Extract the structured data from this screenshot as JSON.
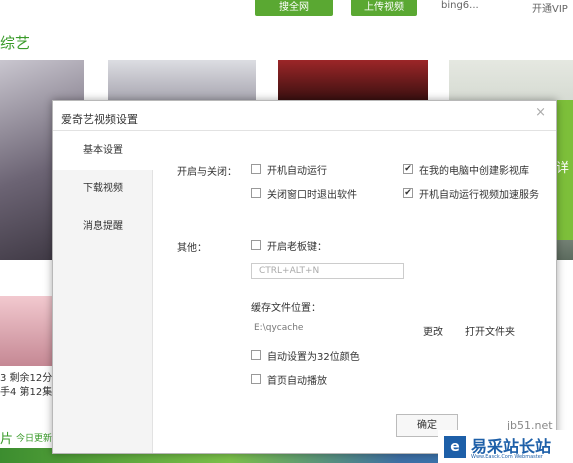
{
  "topbar": {
    "search_label": "搜全网",
    "upload_label": "上传视频",
    "username": "bing6...",
    "vip_label": "开通VIP"
  },
  "background": {
    "category_title": "综艺",
    "side_banner_text": "详",
    "episode_1": "3 剩余12分",
    "episode_2": "手4 第12集",
    "today_icon": "片",
    "today_label": "今日更新"
  },
  "dialog": {
    "title": "爱奇艺视频设置",
    "close_glyph": "×",
    "sidebar": [
      {
        "label": "基本设置",
        "active": true
      },
      {
        "label": "下载视频",
        "active": false
      },
      {
        "label": "消息提醒",
        "active": false
      }
    ],
    "startup": {
      "label": "开启与关闭：",
      "options": [
        {
          "label": "开机自动运行",
          "checked": false
        },
        {
          "label": "在我的电脑中创建影视库",
          "checked": true
        },
        {
          "label": "关闭窗口时退出软件",
          "checked": false
        },
        {
          "label": "开机自动运行视频加速服务",
          "checked": true
        }
      ]
    },
    "other": {
      "label": "其他：",
      "boss_key": {
        "label": "开启老板键：",
        "checked": false
      },
      "hotkey_placeholder": "CTRL+ALT+N",
      "cache_label": "缓存文件位置：",
      "cache_path": "E:\\qycache",
      "change_label": "更改",
      "open_folder_label": "打开文件夹",
      "color32": {
        "label": "自动设置为32位颜色",
        "checked": false
      },
      "autoplay": {
        "label": "首页自动播放",
        "checked": false
      }
    },
    "ok_label": "确定",
    "check_glyph": "✔"
  },
  "watermark": {
    "site_name": "易采站长站",
    "sub": "Www.Easck.Com Webmaster",
    "icon": "e",
    "jb_text": "jb51.net"
  }
}
